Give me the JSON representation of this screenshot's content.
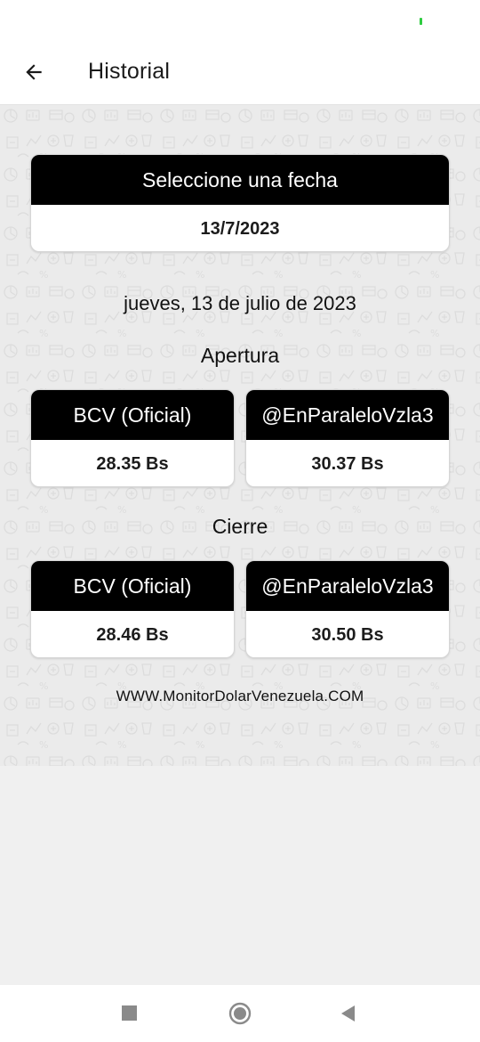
{
  "app_bar": {
    "title": "Historial",
    "back_icon": "arrow-left-icon"
  },
  "date_picker": {
    "header": "Seleccione una fecha",
    "selected_date": "13/7/2023"
  },
  "long_date": "jueves, 13 de julio de 2023",
  "apertura": {
    "title": "Apertura",
    "bcv": {
      "label": "BCV (Oficial)",
      "value": "28.35 Bs"
    },
    "paralelo": {
      "label": "@EnParaleloVzla3",
      "value": "30.37 Bs"
    }
  },
  "cierre": {
    "title": "Cierre",
    "bcv": {
      "label": "BCV (Oficial)",
      "value": "28.46 Bs"
    },
    "paralelo": {
      "label": "@EnParaleloVzla3",
      "value": "30.50 Bs"
    }
  },
  "website": "WWW.MonitorDolarVenezuela.COM",
  "colors": {
    "card_header": "#000000",
    "card_body": "#ffffff",
    "background": "#f0f0f0",
    "signal": "#2ecc40"
  },
  "nav": {
    "recents_icon": "square-icon",
    "home_icon": "circle-icon",
    "back_icon": "triangle-back-icon"
  }
}
